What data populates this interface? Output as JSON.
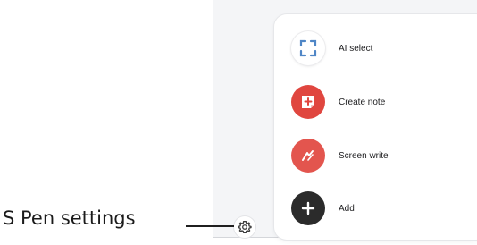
{
  "callout": {
    "label": "S Pen settings"
  },
  "menu": {
    "items": [
      {
        "label": "AI select",
        "icon": "ai-select-icon"
      },
      {
        "label": "Create note",
        "icon": "create-note-icon"
      },
      {
        "label": "Screen write",
        "icon": "screen-write-icon"
      },
      {
        "label": "Add",
        "icon": "add-icon"
      }
    ]
  },
  "settings": {
    "icon": "gear-icon"
  },
  "colors": {
    "ai_select_accent": "#4f86c6",
    "create_note": "#e0463f",
    "screen_write": "#e3554e",
    "add": "#2b2b2b",
    "panel_background": "#f4f5f7"
  }
}
